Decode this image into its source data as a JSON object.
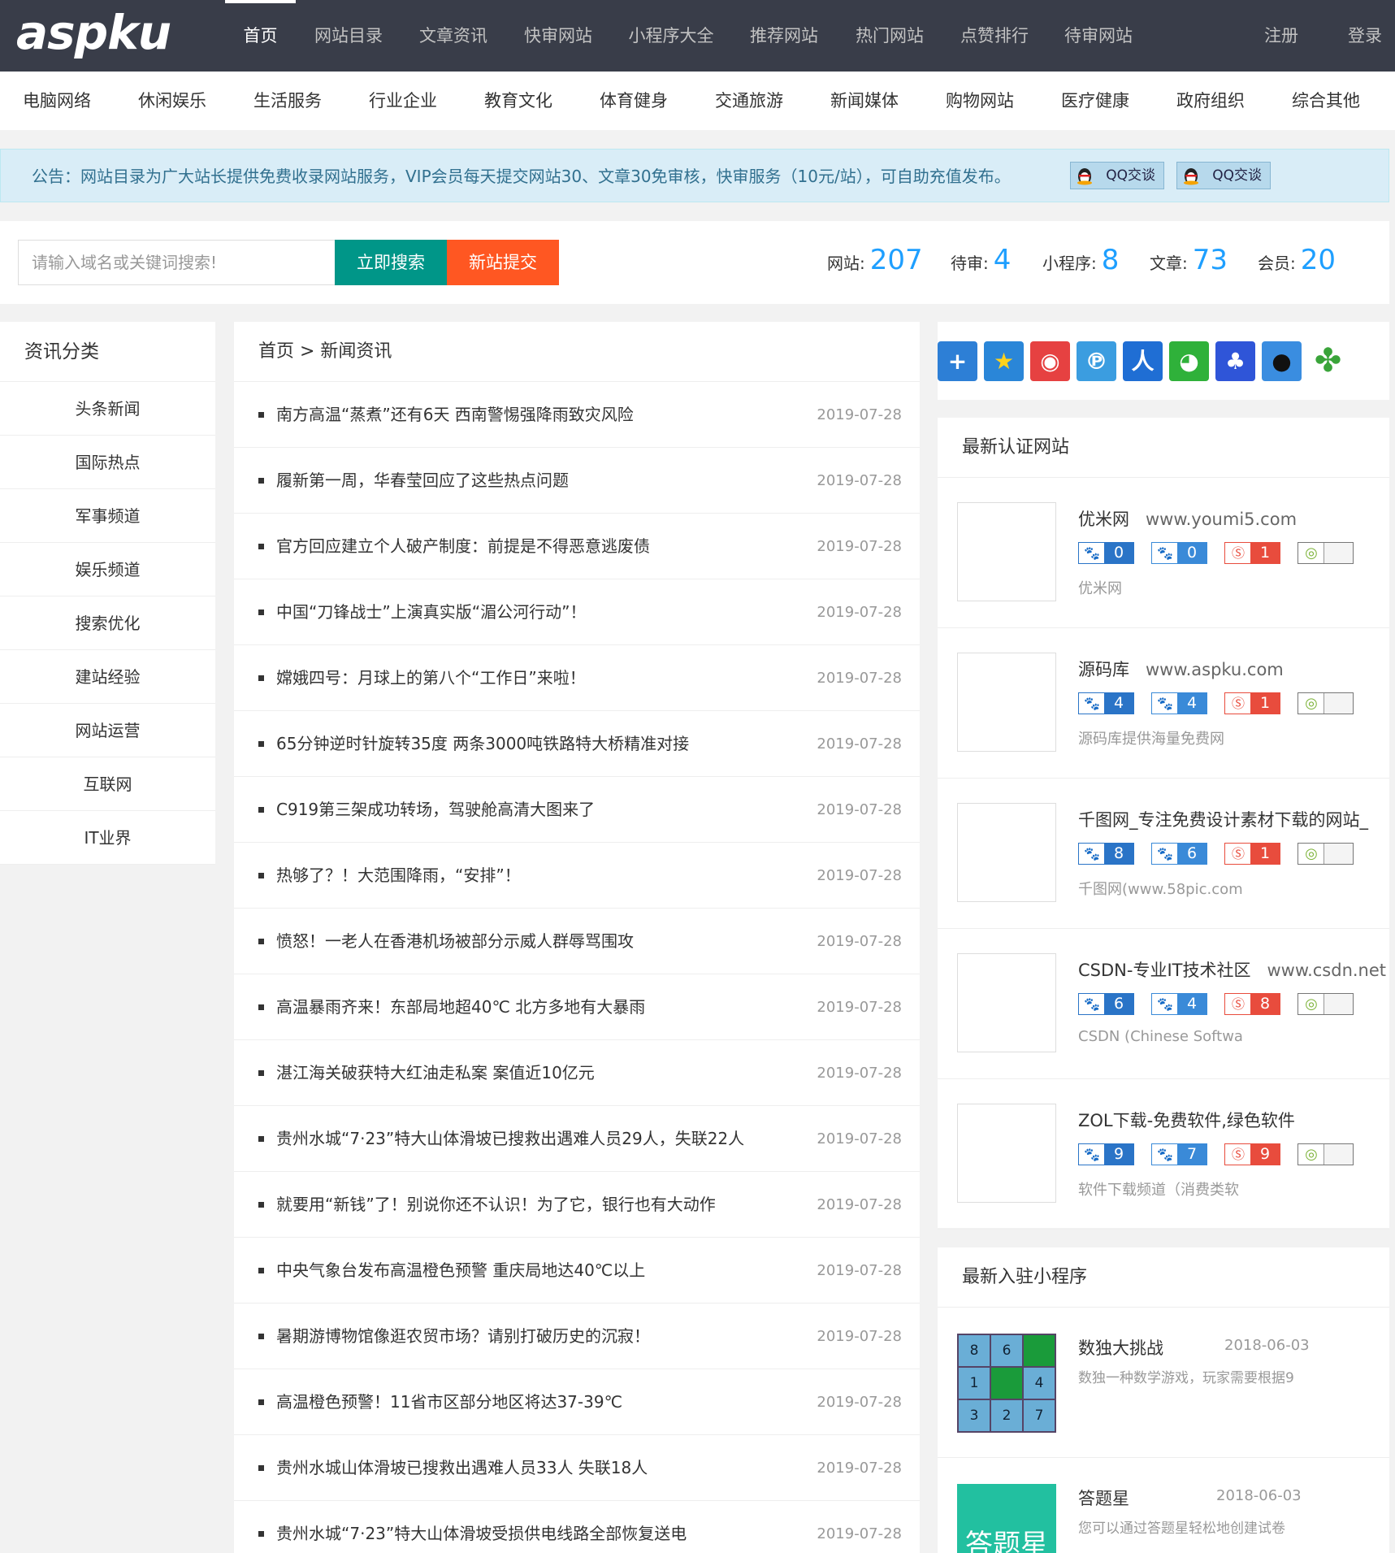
{
  "logo": "aspku",
  "nav": [
    "首页",
    "网站目录",
    "文章资讯",
    "快审网站",
    "小程序大全",
    "推荐网站",
    "热门网站",
    "点赞排行",
    "待审网站"
  ],
  "nav_right": [
    "注册",
    "登录"
  ],
  "categories": [
    "电脑网络",
    "休闲娱乐",
    "生活服务",
    "行业企业",
    "教育文化",
    "体育健身",
    "交通旅游",
    "新闻媒体",
    "购物网站",
    "医疗健康",
    "政府组织",
    "综合其他"
  ],
  "notice": {
    "text": "公告：网站目录为广大站长提供免费收录网站服务，VIP会员每天提交网站30、文章30免审核，快审服务（10元/站），可自助充值发布。",
    "qq_label": "QQ交谈"
  },
  "search": {
    "placeholder": "请输入域名或关键词搜索!",
    "search_btn": "立即搜索",
    "submit_btn": "新站提交"
  },
  "stats": [
    {
      "label": "网站:",
      "value": "207"
    },
    {
      "label": "待审:",
      "value": "4"
    },
    {
      "label": "小程序:",
      "value": "8"
    },
    {
      "label": "文章:",
      "value": "73"
    },
    {
      "label": "会员:",
      "value": "20"
    }
  ],
  "sidebar": {
    "title": "资讯分类",
    "items": [
      "头条新闻",
      "国际热点",
      "军事频道",
      "娱乐频道",
      "搜索优化",
      "建站经验",
      "网站运营",
      "互联网",
      "IT业界"
    ]
  },
  "breadcrumb": "首页 > 新闻资讯",
  "articles": [
    {
      "title": "南方高温“蒸煮”还有6天 西南警惕强降雨致灾风险",
      "date": "2019-07-28"
    },
    {
      "title": "履新第一周，华春莹回应了这些热点问题",
      "date": "2019-07-28"
    },
    {
      "title": "官方回应建立个人破产制度：前提是不得恶意逃废债",
      "date": "2019-07-28"
    },
    {
      "title": "中国“刀锋战士”上演真实版“湄公河行动”！",
      "date": "2019-07-28"
    },
    {
      "title": "嫦娥四号：月球上的第八个“工作日”来啦！",
      "date": "2019-07-28"
    },
    {
      "title": "65分钟逆时针旋转35度 两条3000吨铁路特大桥精准对接",
      "date": "2019-07-28"
    },
    {
      "title": "C919第三架成功转场，驾驶舱高清大图来了",
      "date": "2019-07-28"
    },
    {
      "title": "热够了？！大范围降雨，“安排”！",
      "date": "2019-07-28"
    },
    {
      "title": "愤怒！一老人在香港机场被部分示威人群辱骂围攻",
      "date": "2019-07-28"
    },
    {
      "title": "高温暴雨齐来！东部局地超40℃ 北方多地有大暴雨",
      "date": "2019-07-28"
    },
    {
      "title": "湛江海关破获特大红油走私案 案值近10亿元",
      "date": "2019-07-28"
    },
    {
      "title": "贵州水城“7·23”特大山体滑坡已搜救出遇难人员29人，失联22人",
      "date": "2019-07-28"
    },
    {
      "title": "就要用“新钱”了！别说你还不认识！为了它，银行也有大动作",
      "date": "2019-07-28"
    },
    {
      "title": "中央气象台发布高温橙色预警 重庆局地达40℃以上",
      "date": "2019-07-28"
    },
    {
      "title": "暑期游博物馆像逛农贸市场？请别打破历史的沉寂！",
      "date": "2019-07-28"
    },
    {
      "title": "高温橙色预警！11省市区部分地区将达37-39℃",
      "date": "2019-07-28"
    },
    {
      "title": "贵州水城山体滑坡已搜救出遇难人员33人 失联18人",
      "date": "2019-07-28"
    },
    {
      "title": "贵州水城“7·23”特大山体滑坡受损供电线路全部恢复送电",
      "date": "2019-07-28"
    }
  ],
  "share_icons": [
    "plus-share-icon",
    "qzone-icon",
    "weibo-icon",
    "tencent-weibo-icon",
    "renren-icon",
    "wechat-icon",
    "baidu-icon",
    "qq-icon",
    "kaixin-icon"
  ],
  "certified": {
    "title": "最新认证网站",
    "sites": [
      {
        "name": "优米网",
        "url": "www.youmi5.com",
        "bd": "0",
        "bdm": "0",
        "so": "1",
        "desc": "优米网"
      },
      {
        "name": "源码库",
        "url": "www.aspku.com",
        "bd": "4",
        "bdm": "4",
        "so": "1",
        "desc": "源码库提供海量免费网"
      },
      {
        "name": "千图网_专注免费设计素材下载的网站_",
        "url": "",
        "bd": "8",
        "bdm": "6",
        "so": "1",
        "desc": "千图网(www.58pic.com"
      },
      {
        "name": "CSDN-专业IT技术社区",
        "url": "www.csdn.net",
        "bd": "6",
        "bdm": "4",
        "so": "8",
        "desc": "CSDN (Chinese Softwa"
      },
      {
        "name": "ZOL下载-免费软件,绿色软件",
        "url": "",
        "bd": "9",
        "bdm": "7",
        "so": "9",
        "desc": "软件下载频道（消费类软"
      }
    ]
  },
  "mini_programs": {
    "title": "最新入驻小程序",
    "items": [
      {
        "name": "数独大挑战",
        "date": "2018-06-03",
        "desc": "数独一种数学游戏，玩家需要根据9",
        "grid": [
          "8",
          "6",
          "",
          "1",
          "",
          "4",
          "3",
          "2",
          "7"
        ]
      },
      {
        "name": "答题星",
        "date": "2018-06-03",
        "desc": "您可以通过答题星轻松地创建试卷",
        "logo_text": "答题星"
      }
    ]
  },
  "colors": {
    "topbar": "#393d49",
    "accent_blue": "#1e9fff",
    "search_green": "#009688",
    "submit_orange": "#ff5722",
    "notice_bg": "#d9edf7"
  }
}
